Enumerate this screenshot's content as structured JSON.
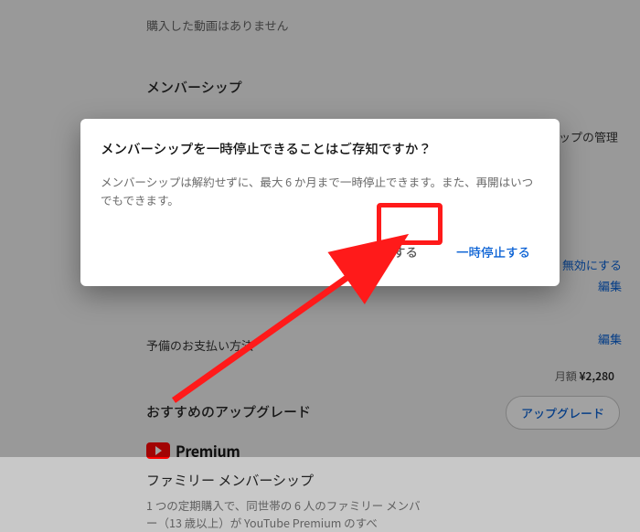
{
  "page": {
    "no_purchase_msg": "購入した動画はありません",
    "membership_heading": "メンバーシップ",
    "manage_membership": "ップの管理",
    "disable_link": "無効にする",
    "edit_link": "編集",
    "backup_payment": "予備のお支払い方法",
    "recommended_upgrade": "おすすめのアップグレード",
    "premium_word": "Premium",
    "family_title": "ファミリー メンバーシップ",
    "family_desc": "1 つの定期購入で、同世帯の 6 人のファミリー メンバー（13 歳以上）が YouTube Premium のすべ",
    "price_label": "月額",
    "price_value": "¥2,280",
    "upgrade_btn": "アップグレード"
  },
  "dialog": {
    "title": "メンバーシップを一時停止できることはご存知ですか？",
    "body": "メンバーシップは解約せずに、最大 6 か月まで一時停止できます。また、再開はいつでもできます。",
    "cancel_membership_btn": "解約する",
    "pause_btn": "一時停止する"
  }
}
